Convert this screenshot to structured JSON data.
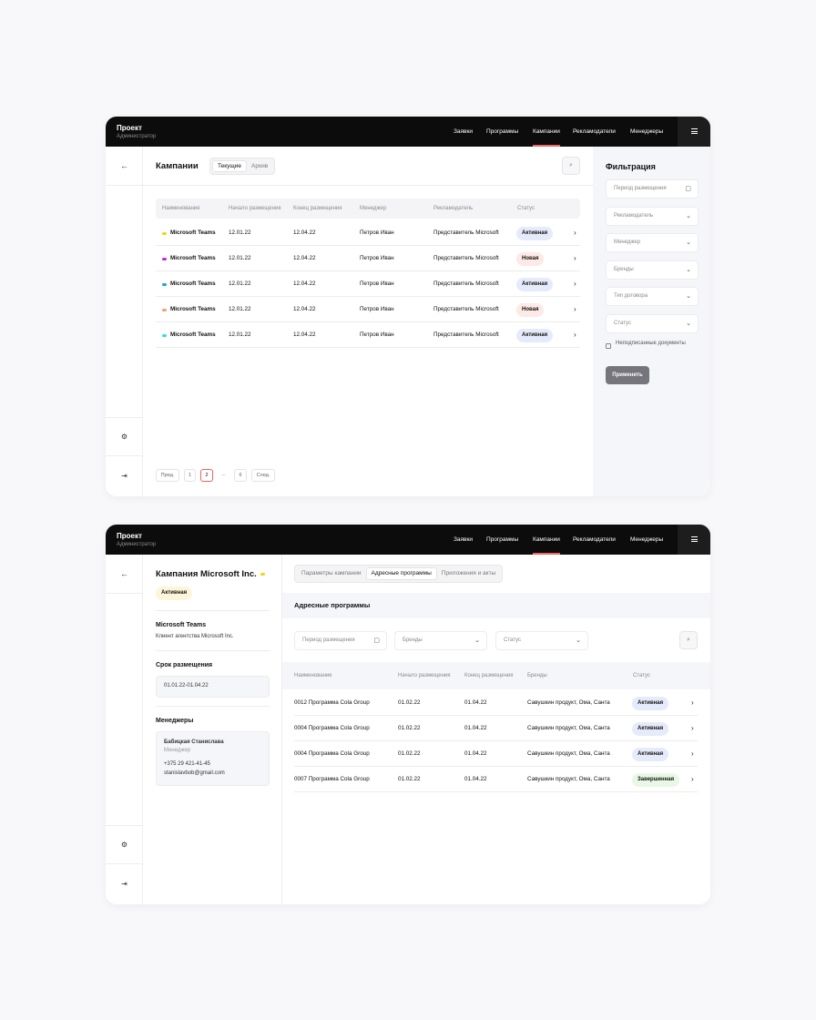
{
  "topbar": {
    "brand_title": "Проект",
    "brand_subtitle": "Администратор",
    "nav": [
      "Заявки",
      "Программы",
      "Кампании",
      "Рекламодатели",
      "Менеджеры"
    ],
    "active_nav": "Кампании",
    "accent_color": "#f06161"
  },
  "icons": {
    "back": "←",
    "settings": "⚙",
    "logout": "⇥",
    "chevron_right": "›",
    "chevron_down": "⌄",
    "calendar": "▢",
    "search": "⌕",
    "menu": "hamburger"
  },
  "campaigns": {
    "title": "Кампании",
    "tabs": [
      "Текущие",
      "Архив"
    ],
    "columns": [
      "Наименование",
      "Начало размещения",
      "Конец размещения",
      "Менеджер",
      "Рекламодатель",
      "Статус"
    ],
    "rows": [
      {
        "name": "Microsoft Teams",
        "dot": "#f5d60a",
        "start": "12.01.22",
        "end": "12.04.22",
        "manager": "Петров Иван",
        "advertiser": "Представитель Microsoft",
        "status": "Активная",
        "status_bg": "#e6ebfb"
      },
      {
        "name": "Microsoft Teams",
        "dot": "#c227e8",
        "start": "12.01.22",
        "end": "12.04.22",
        "manager": "Петров Иван",
        "advertiser": "Представитель Microsoft",
        "status": "Новая",
        "status_bg": "#fde9e6"
      },
      {
        "name": "Microsoft Teams",
        "dot": "#21a3e0",
        "start": "12.01.22",
        "end": "12.04.22",
        "manager": "Петров Иван",
        "advertiser": "Представитель Microsoft",
        "status": "Активная",
        "status_bg": "#e6ebfb"
      },
      {
        "name": "Microsoft Teams",
        "dot": "#f0a070",
        "start": "12.01.22",
        "end": "12.04.22",
        "manager": "Петров Иван",
        "advertiser": "Представитель Microsoft",
        "status": "Новая",
        "status_bg": "#fde9e6"
      },
      {
        "name": "Microsoft Teams",
        "dot": "#2ee0e0",
        "start": "12.01.22",
        "end": "12.04.22",
        "manager": "Петров Иван",
        "advertiser": "Представитель Microsoft",
        "status": "Активная",
        "status_bg": "#e6ebfb"
      }
    ],
    "pagination": {
      "prev": "Пред.",
      "pages": [
        "1",
        "2",
        "...",
        "6"
      ],
      "current": "2",
      "next": "След."
    }
  },
  "filters": {
    "title": "Фильтрация",
    "fields": [
      "Период размещения",
      "Рекламодатель",
      "Менеджер",
      "Бренды",
      "Тип договора",
      "Статус"
    ],
    "checkbox_label": "Неподписанные документы",
    "apply": "Применить"
  },
  "campaign_detail": {
    "title": "Кампания Microsoft Inc.",
    "title_dot": "#f5d60a",
    "status": "Активная",
    "status_bg": "#fdf5d9",
    "client_name": "Microsoft Teams",
    "client_desc": "Клиент агентства Microsoft Inc.",
    "period_label": "Срок размещения",
    "period_value": "01.01.22-01.04.22",
    "managers_label": "Менеджеры",
    "manager_name": "Бабицкая Станислава",
    "manager_role": "Менеджер",
    "manager_phone": "+375 29 421-41-45",
    "manager_email": "stanislavbob@gmail.com"
  },
  "address_programs": {
    "tabs": [
      "Параметры кампании",
      "Адресные программы",
      "Приложения и акты"
    ],
    "active_tab": "Адресные программы",
    "title": "Адресные программы",
    "filter_period": "Период размещения",
    "filter_brands": "Бренды",
    "filter_status": "Статус",
    "columns": [
      "Наименование",
      "Начало размещения",
      "Конец размещения",
      "Бренды",
      "Статус"
    ],
    "rows": [
      {
        "name": "0012 Программа Cola Group",
        "start": "01.02.22",
        "end": "01.04.22",
        "brands": "Савушкин продукт, Ома, Санта",
        "status": "Активная",
        "status_bg": "#e6ebfb"
      },
      {
        "name": "0004 Программа Cola Group",
        "start": "01.02.22",
        "end": "01.04.22",
        "brands": "Савушкин продукт, Ома, Санта",
        "status": "Активная",
        "status_bg": "#e6ebfb"
      },
      {
        "name": "0004 Программа Cola Group",
        "start": "01.02.22",
        "end": "01.04.22",
        "brands": "Савушкин продукт, Ома, Санта",
        "status": "Активная",
        "status_bg": "#e6ebfb"
      },
      {
        "name": "0007 Программа Cola Group",
        "start": "01.02.22",
        "end": "01.04.22",
        "brands": "Савушкин продукт, Ома, Санта",
        "status": "Завершенная",
        "status_bg": "#e9f8e4"
      }
    ]
  }
}
